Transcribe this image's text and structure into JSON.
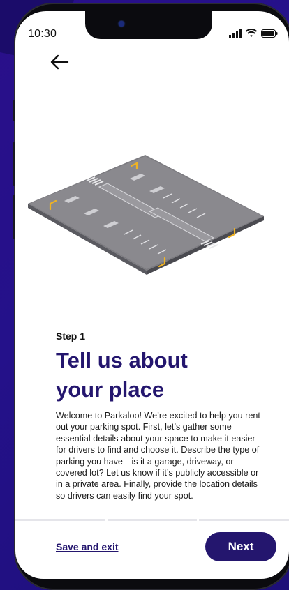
{
  "status_bar": {
    "time": "10:30"
  },
  "onboarding": {
    "step_label": "Step 1",
    "title": "Tell us about your place",
    "description": "Welcome to Parkaloo! We’re excited to help you rent out your parking spot. First, let’s gather some essential details about your space to make it easier for drivers to find and choose it. Describe the type of parking you have—is it a garage, driveway, or covered lot? Let us know if it’s publicly accessible or in a private area. Finally, provide the location details so drivers can easily find your spot."
  },
  "footer": {
    "save_label": "Save and exit",
    "next_label": "Next"
  },
  "colors": {
    "brand": "#24166e",
    "background": "#24118a"
  },
  "icons": [
    "back-arrow-icon",
    "signal-icon",
    "wifi-icon",
    "battery-icon",
    "parking-lot-illustration"
  ]
}
